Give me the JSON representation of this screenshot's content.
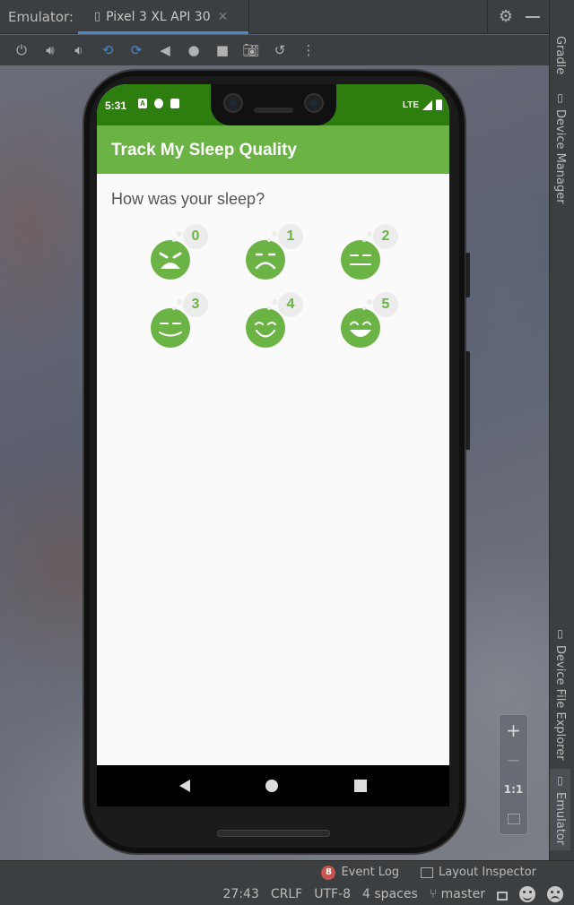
{
  "ide": {
    "panel_label": "Emulator:",
    "device_tab": {
      "title": "Pixel 3 XL API 30",
      "close": "✕"
    },
    "toolbar_icons": [
      "power-icon",
      "volume-up-icon",
      "volume-down-icon",
      "rotate-left-icon",
      "rotate-right-icon",
      "back-icon",
      "home-icon",
      "overview-icon",
      "camera-icon",
      "snapshot-icon",
      "more-icon"
    ],
    "side_tools": {
      "gradle": "Gradle",
      "device_manager": "Device Manager",
      "device_file_explorer": "Device File Explorer",
      "emulator": "Emulator"
    },
    "zoom": {
      "plus": "+",
      "minus": "−",
      "one_to_one": "1:1"
    },
    "status_bar": {
      "event_log_count": "8",
      "event_log": "Event Log",
      "layout_inspector": "Layout Inspector",
      "position": "27:43",
      "line_sep": "CRLF",
      "encoding": "UTF-8",
      "indent": "4 spaces",
      "branch": "master"
    }
  },
  "device": {
    "status_time": "5:31",
    "network": "LTE",
    "app_title": "Track My Sleep Quality",
    "prompt": "How was your sleep?",
    "ratings": [
      "0",
      "1",
      "2",
      "3",
      "4",
      "5"
    ],
    "accent_color": "#6ab344",
    "status_color": "#2e7d0f"
  }
}
